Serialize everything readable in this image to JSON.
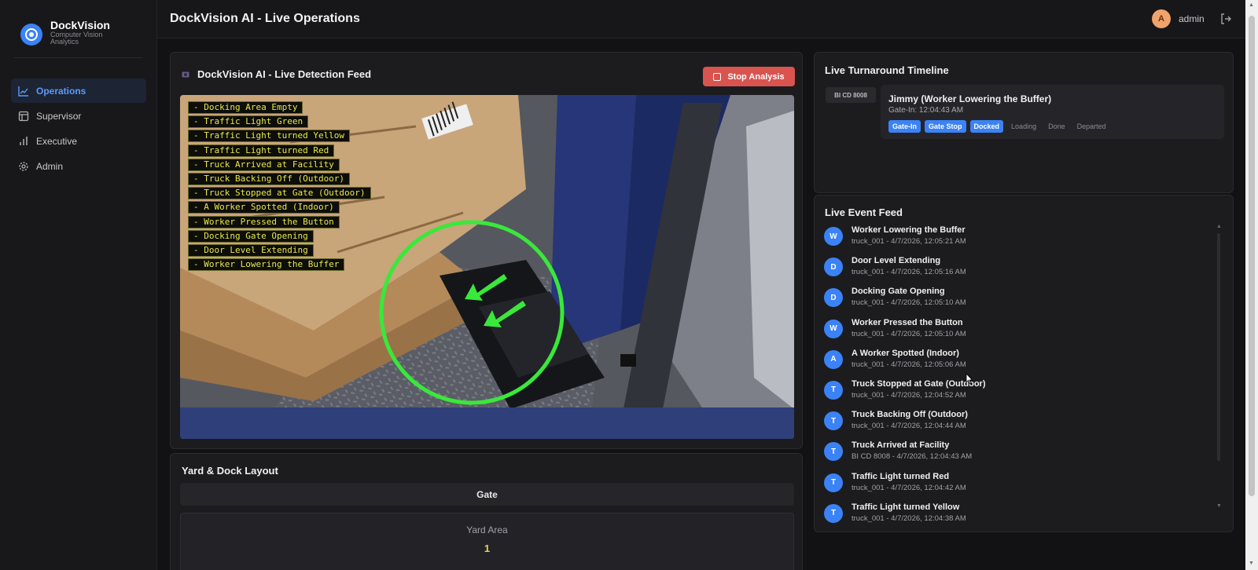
{
  "brand": {
    "name": "DockVision",
    "subtitle": "Computer Vision Analytics"
  },
  "nav": [
    {
      "label": "Operations",
      "icon": "chart-line-icon",
      "active": true
    },
    {
      "label": "Supervisor",
      "icon": "monitor-icon",
      "active": false
    },
    {
      "label": "Executive",
      "icon": "bar-chart-icon",
      "active": false
    },
    {
      "label": "Admin",
      "icon": "gear-icon",
      "active": false
    }
  ],
  "header": {
    "title": "DockVision AI - Live Operations",
    "avatar_initial": "A",
    "username": "admin"
  },
  "feed": {
    "title": "DockVision AI - Live Detection Feed",
    "stop_label": "Stop Analysis",
    "detections": [
      "- Docking Area Empty",
      "- Traffic Light Green",
      "- Traffic Light turned Yellow",
      "- Traffic Light turned Red",
      "- Truck Arrived at Facility",
      "- Truck Backing Off (Outdoor)",
      "- Truck Stopped at Gate (Outdoor)",
      "- A Worker Spotted (Indoor)",
      "- Worker Pressed the Button",
      "- Docking Gate Opening",
      "- Door Level Extending",
      "- Worker Lowering the Buffer"
    ]
  },
  "yard": {
    "title": "Yard & Dock Layout",
    "gate_label": "Gate",
    "area_label": "Yard Area",
    "area_count": "1"
  },
  "timeline": {
    "title": "Live Turnaround Timeline",
    "plate": "BI CD 8008",
    "name": "Jimmy (Worker Lowering the Buffer)",
    "gate_in": "Gate-In: 12:04:43 AM",
    "stages": [
      {
        "label": "Gate-In",
        "done": true
      },
      {
        "label": "Gate Stop",
        "done": true
      },
      {
        "label": "Docked",
        "done": true
      },
      {
        "label": "Loading",
        "done": false
      },
      {
        "label": "Done",
        "done": false
      },
      {
        "label": "Departed",
        "done": false
      }
    ]
  },
  "events": {
    "title": "Live Event Feed",
    "items": [
      {
        "initial": "W",
        "name": "Worker Lowering the Buffer",
        "meta": "truck_001 - 4/7/2026, 12:05:21 AM"
      },
      {
        "initial": "D",
        "name": "Door Level Extending",
        "meta": "truck_001 - 4/7/2026, 12:05:16 AM"
      },
      {
        "initial": "D",
        "name": "Docking Gate Opening",
        "meta": "truck_001 - 4/7/2026, 12:05:10 AM"
      },
      {
        "initial": "W",
        "name": "Worker Pressed the Button",
        "meta": "truck_001 - 4/7/2026, 12:05:10 AM"
      },
      {
        "initial": "A",
        "name": "A Worker Spotted (Indoor)",
        "meta": "truck_001 - 4/7/2026, 12:05:06 AM"
      },
      {
        "initial": "T",
        "name": "Truck Stopped at Gate (Outdoor)",
        "meta": "truck_001 - 4/7/2026, 12:04:52 AM"
      },
      {
        "initial": "T",
        "name": "Truck Backing Off (Outdoor)",
        "meta": "truck_001 - 4/7/2026, 12:04:44 AM"
      },
      {
        "initial": "T",
        "name": "Truck Arrived at Facility",
        "meta": "BI CD 8008 - 4/7/2026, 12:04:43 AM"
      },
      {
        "initial": "T",
        "name": "Traffic Light turned Red",
        "meta": "truck_001 - 4/7/2026, 12:04:42 AM"
      },
      {
        "initial": "T",
        "name": "Traffic Light turned Yellow",
        "meta": "truck_001 - 4/7/2026, 12:04:38 AM"
      }
    ]
  },
  "colors": {
    "accent": "#3b82f6",
    "danger": "#d9534f",
    "detection": "#e8e84a",
    "ring": "#39e83a"
  }
}
